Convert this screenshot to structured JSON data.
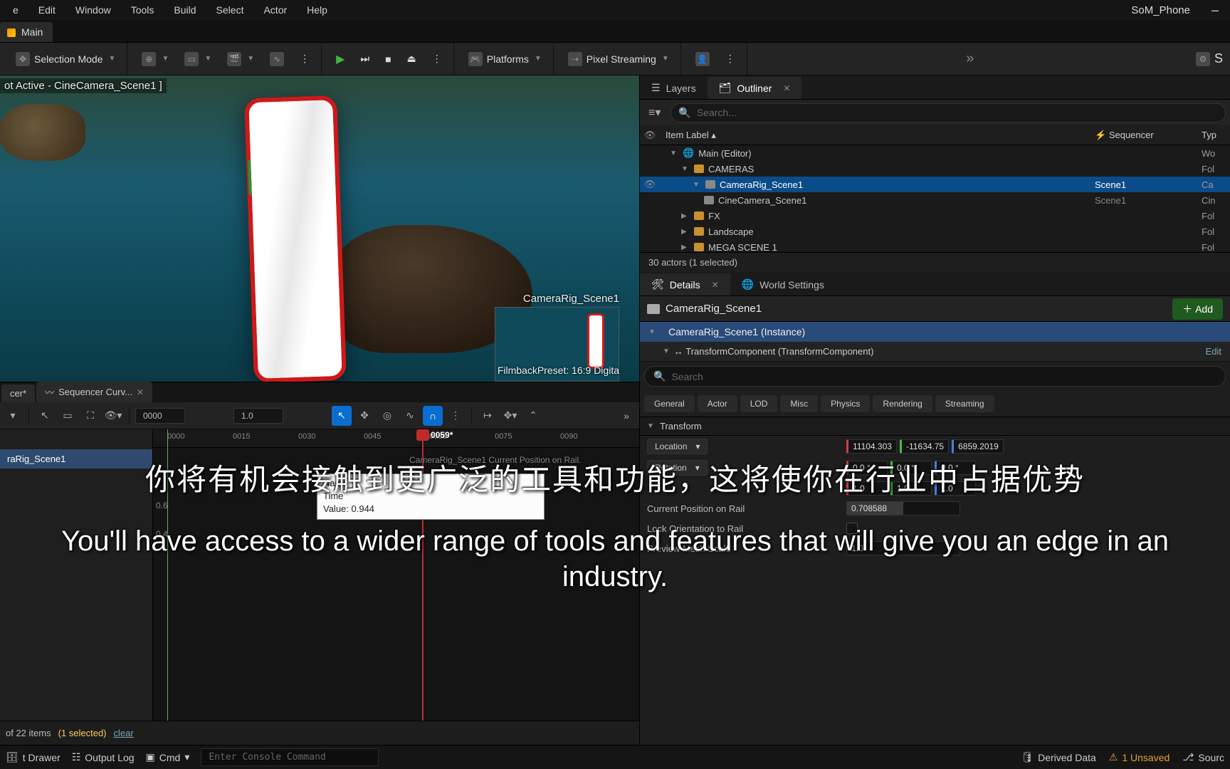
{
  "menu": [
    "e",
    "Edit",
    "Window",
    "Tools",
    "Build",
    "Select",
    "Actor",
    "Help"
  ],
  "project": "SoM_Phone",
  "mainTab": "Main",
  "toolbar": {
    "selMode": "Selection Mode",
    "platforms": "Platforms",
    "pixelStream": "Pixel Streaming",
    "settingsShort": "S"
  },
  "viewport": {
    "status": "ot Active - CineCamera_Scene1 ]",
    "pipName": "CameraRig_Scene1",
    "pipPreset": "FilmbackPreset: 16:9 Digita"
  },
  "sequencer": {
    "tab1": "cer*",
    "tab2": "Sequencer Curv...",
    "num1": "0000",
    "num2": "1.0",
    "track": "raRig_Scene1",
    "ticks": [
      "0000",
      "0015",
      "0030",
      "0045",
      "0060",
      "0075",
      "0090"
    ],
    "playhead": "0059*",
    "tipName": "CameraRig_Scene1 Current Position on Rail.",
    "tipLine1": "Name",
    "tipLine2": "Time",
    "tipLine3": "Value: 0.944",
    "yLabels": [
      "0.6",
      "0.4"
    ],
    "footItems": "of 22 items",
    "footSel": "(1 selected)",
    "footClear": "clear"
  },
  "panels": {
    "layers": "Layers",
    "outliner": "Outliner",
    "searchPH": "Search...",
    "colItem": "Item Label",
    "colSeq": "Sequencer",
    "colType": "Typ",
    "count": "30 actors (1 selected)"
  },
  "outliner": [
    {
      "label": "Main (Editor)",
      "type": "Wo",
      "indent": 1,
      "open": true,
      "folder": false,
      "root": true
    },
    {
      "label": "CAMERAS",
      "type": "Fol",
      "indent": 2,
      "open": true,
      "folder": true
    },
    {
      "label": "CameraRig_Scene1",
      "seq": "Scene1",
      "type": "Ca",
      "indent": 3,
      "cam": true,
      "sel": true,
      "eye": true
    },
    {
      "label": "CineCamera_Scene1",
      "seq": "Scene1",
      "type": "Cin",
      "indent": 4,
      "cam": true
    },
    {
      "label": "FX",
      "type": "Fol",
      "indent": 2,
      "folder": true
    },
    {
      "label": "Landscape",
      "type": "Fol",
      "indent": 2,
      "folder": true
    },
    {
      "label": "MEGA SCENE 1",
      "type": "Fol",
      "indent": 2,
      "folder": true
    }
  ],
  "details": {
    "tab1": "Details",
    "tab2": "World Settings",
    "actor": "CameraRig_Scene1",
    "add": "Add",
    "instance": "CameraRig_Scene1 (Instance)",
    "component": "TransformComponent (TransformComponent)",
    "edit": "Edit",
    "searchPH": "Search",
    "cats": [
      "General",
      "Actor",
      "LOD",
      "Misc",
      "Physics",
      "Rendering",
      "Streaming"
    ],
    "sectTransform": "Transform",
    "location": "Location",
    "locVals": [
      "11104.303",
      "-11634.75",
      "6859.2019"
    ],
    "rotation": "Rotation",
    "rotVals": [
      "0.0 °",
      "0.0 °",
      "0.0 °"
    ],
    "scaleVals": [
      "1.0",
      "1.0",
      "1.0"
    ],
    "railPos": "Current Position on Rail",
    "railPosVal": "0.708588",
    "lockOrient": "Lock Orientation to Rail",
    "meshScale": "Preview Mesh Scale",
    "meshScaleVal": "1.0"
  },
  "status": {
    "drawer": "t Drawer",
    "output": "Output Log",
    "cmd": "Cmd",
    "consolePH": "Enter Console Command",
    "derived": "Derived Data",
    "unsaved": "1 Unsaved",
    "source": "Sourc"
  },
  "subtitles": {
    "cn": "你将有机会接触到更广泛的工具和功能，这将使你在行业中占据优势",
    "en": "You'll have access to a wider range of tools and features that will give you an edge in an industry."
  }
}
